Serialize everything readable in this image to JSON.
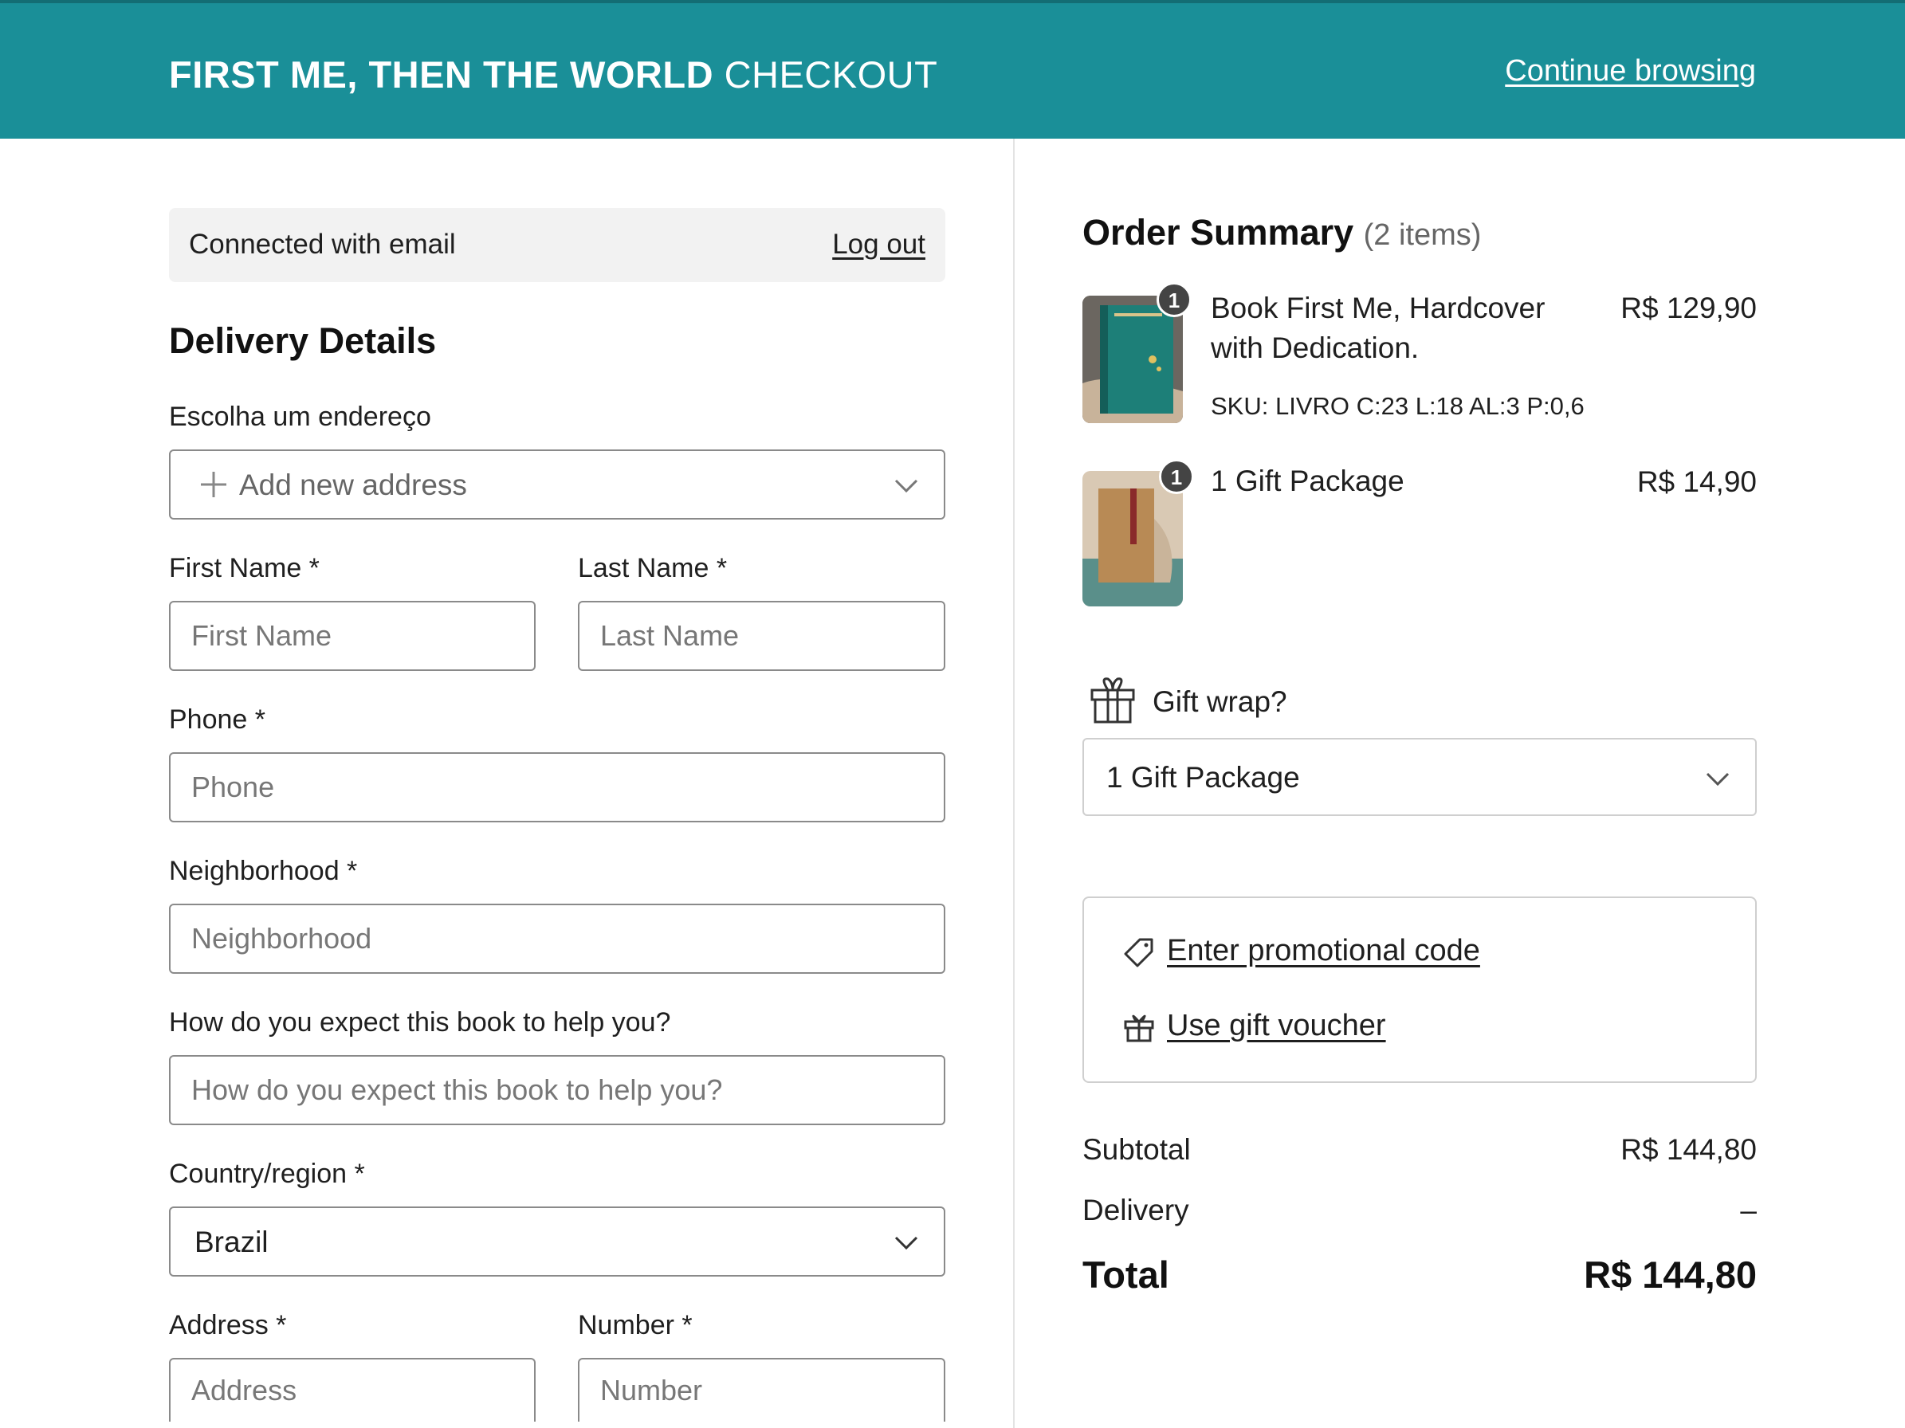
{
  "header": {
    "brand_strong": "FIRST ME, THEN THE WORLD",
    "brand_light": "CHECKOUT",
    "continue_link": "Continue browsing",
    "color": "#1a8f98"
  },
  "account": {
    "connected_text": "Connected with email",
    "logout_label": "Log out"
  },
  "delivery": {
    "title": "Delivery Details",
    "address_choice_label": "Escolha um endereço",
    "address_choice_value": "Add new address",
    "first_name": {
      "label": "First Name *",
      "placeholder": "First Name"
    },
    "last_name": {
      "label": "Last Name *",
      "placeholder": "Last Name"
    },
    "phone": {
      "label": "Phone *",
      "placeholder": "Phone"
    },
    "neighborhood": {
      "label": "Neighborhood *",
      "placeholder": "Neighborhood"
    },
    "expectation": {
      "label": "How do you expect this book to help you?",
      "placeholder": "How do you expect this book to help you?"
    },
    "country": {
      "label": "Country/region *",
      "value": "Brazil"
    },
    "address": {
      "label": "Address *",
      "placeholder": "Address"
    },
    "number": {
      "label": "Number *",
      "placeholder": "Number"
    }
  },
  "summary": {
    "title": "Order Summary",
    "count": "(2 items)",
    "items": [
      {
        "quantity": "1",
        "name": "Book First Me, Hardcover with Dedication.",
        "sku": "SKU: LIVRO C:23 L:18 AL:3 P:0,6",
        "price": "R$ 129,90",
        "image_icon": "book-thumbnail"
      },
      {
        "quantity": "1",
        "name": "1 Gift Package",
        "price": "R$ 14,90",
        "image_icon": "gift-package-thumbnail"
      }
    ],
    "gift_wrap": {
      "label": "Gift wrap?",
      "value": "1 Gift Package"
    },
    "promo": {
      "code_label": "Enter promotional code",
      "voucher_label": "Use gift voucher"
    },
    "totals": {
      "subtotal_label": "Subtotal",
      "subtotal_value": "R$ 144,80",
      "delivery_label": "Delivery",
      "delivery_value": "–",
      "total_label": "Total",
      "total_value": "R$ 144,80"
    }
  }
}
